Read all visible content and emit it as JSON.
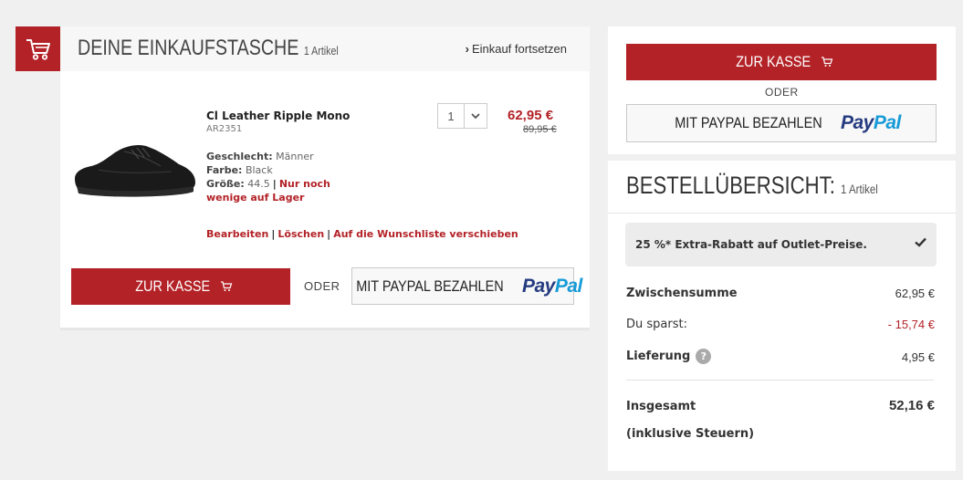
{
  "bag": {
    "title": "DEINE EINKAUFSTASCHE",
    "count": "1 Artikel",
    "continue_label": "Einkauf fortsetzen"
  },
  "item": {
    "name": "Cl Leather Ripple Mono",
    "sku": "AR2351",
    "gender_label": "Geschlecht:",
    "gender_value": "Männer",
    "color_label": "Farbe:",
    "color_value": "Black",
    "size_label": "Größe:",
    "size_value": "44.5",
    "stock_warning_1": "Nur noch",
    "stock_warning_2": "wenige auf Lager",
    "quantity": "1",
    "price_now": "62,95 €",
    "price_old": "89,95 €",
    "actions": {
      "edit": "Bearbeiten",
      "delete": "Löschen",
      "wishlist": "Auf die Wunschliste verschieben"
    }
  },
  "checkout": {
    "checkout_label": "ZUR KASSE",
    "or_label": "ODER",
    "paypal_label": "MIT PAYPAL BEZAHLEN",
    "paypal_logo_1": "Pay",
    "paypal_logo_2": "Pal"
  },
  "summary": {
    "title": "BESTELLÜBERSICHT:",
    "count": "1 Artikel",
    "promo": "25 %* Extra-Rabatt auf Outlet-Preise.",
    "subtotal_label": "Zwischensumme",
    "subtotal_value": "62,95 €",
    "savings_label": "Du sparst:",
    "savings_value": "- 15,74 €",
    "shipping_label": "Lieferung",
    "shipping_help": "?",
    "shipping_value": "4,95 €",
    "total_label": "Insgesamt",
    "total_value": "52,16 €",
    "tax_note": "(inklusive Steuern)"
  },
  "colors": {
    "brand_red": "#b32227",
    "paypal_dark": "#253b80",
    "paypal_light": "#179bd7"
  }
}
